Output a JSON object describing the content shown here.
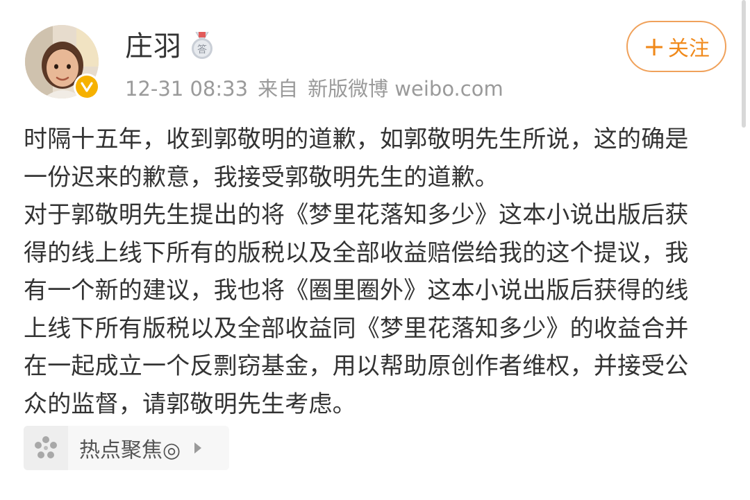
{
  "user": {
    "name": "庄羽",
    "badge_icon": "medal-answer-icon",
    "verified_icon": "verified-v-icon",
    "avatar": "avatar-girl"
  },
  "meta": {
    "time": "12-31 08:33",
    "from_label": "来自",
    "client": "新版微博 weibo.com"
  },
  "follow": {
    "plus": "+",
    "label": "关注",
    "color": "#f08a1c"
  },
  "post": {
    "paragraph_1": "时隔十五年，收到郭敬明的道歉，如郭敬明先生所说，这的确是\n一份迟来的歉意，我接受郭敬明先生的道歉。",
    "paragraph_2": "对于郭敬明先生提出的将《梦里花落知多少》这本小说出版后获\n得的线上线下所有的版税以及全部收益赔偿给我的这个提议，我\n有一个新的建议，我也将《圈里圈外》这本小说出版后获得的线\n上线下所有版税以及全部收益同《梦里花落知多少》的收益合并\n在一起成立一个反剽窃基金，用以帮助原创作者维权，并接受公\n众的监督，请郭敬明先生考虑。"
  },
  "topic": {
    "label": "热点聚焦◎",
    "icon": "topic-flower-icon",
    "arrow_icon": "play-arrow-icon"
  }
}
